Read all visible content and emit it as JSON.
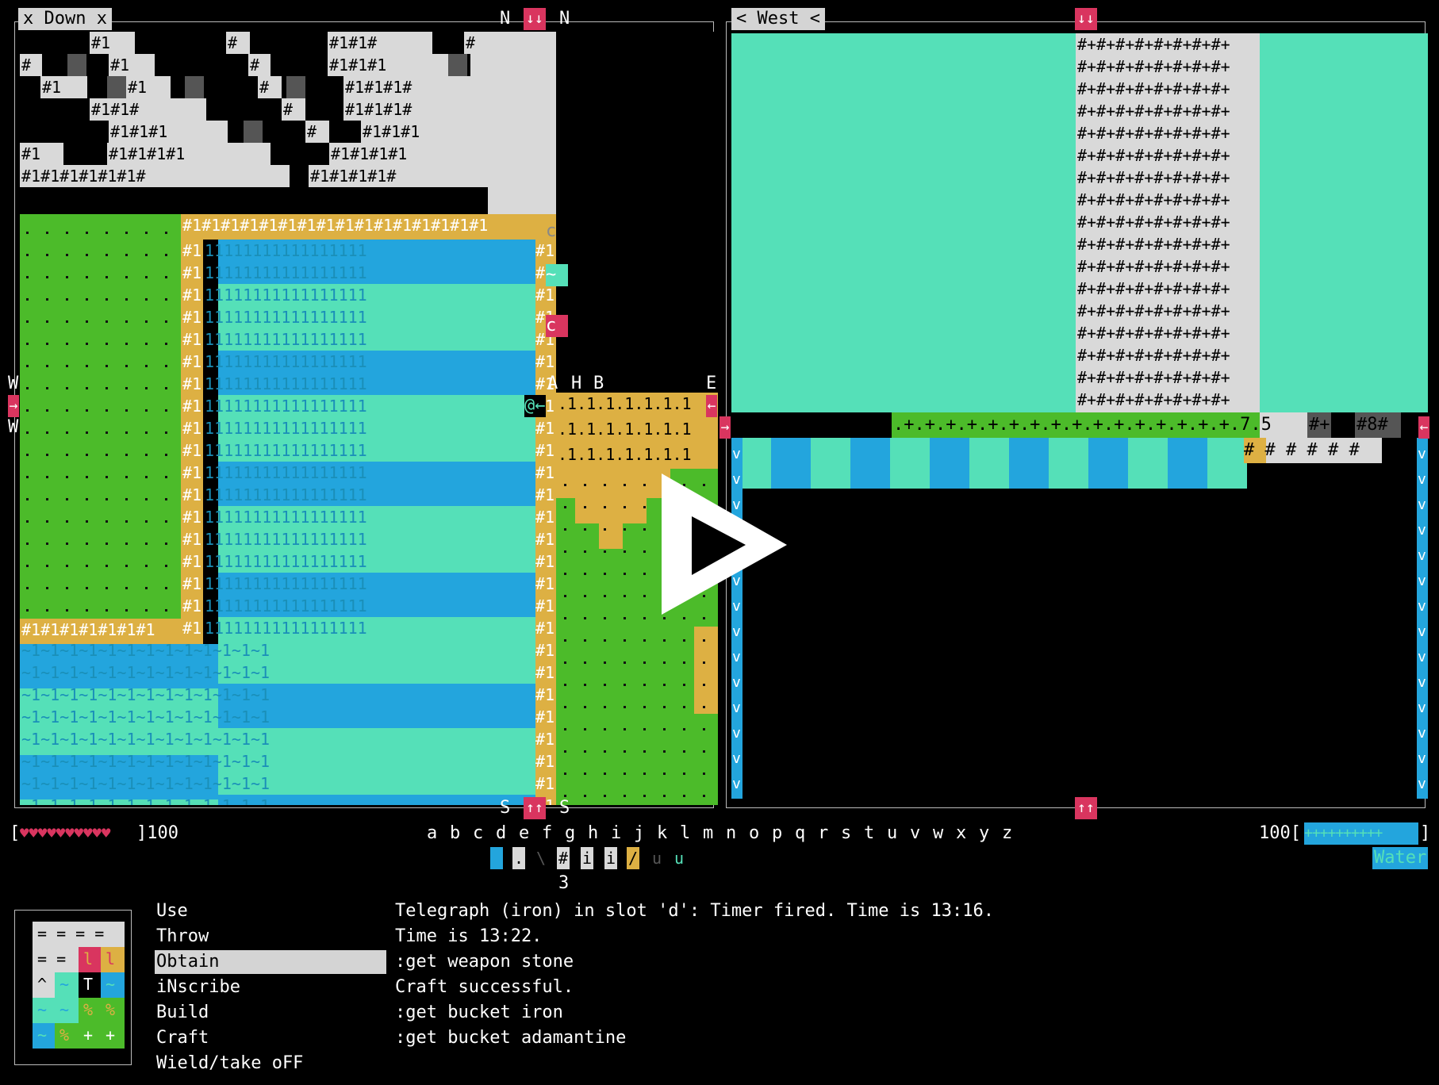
{
  "left_pane": {
    "title": "x Down x",
    "compass": {
      "north": "N",
      "south": "S",
      "west": "W",
      "east": "E"
    },
    "up_arrows": "↑↑",
    "down_arrows": "↓↓",
    "side_letters": [
      "A",
      "H",
      "B"
    ],
    "player_glyph": "@←",
    "side_markers": {
      "c1": "c",
      "tilde": "~",
      "c2": "c"
    }
  },
  "right_pane": {
    "title": "< West <",
    "down_arrows": "↓↓",
    "up_arrows": "↑↑",
    "strip_text": ".+.+.+.+.+.+.+.+.+.+.+.+.+.+.+.+.7.5",
    "strip_tail_1": "#+",
    "strip_tail_2": "#8#",
    "hash_row": "# # # # # #"
  },
  "status": {
    "hearts": "♥♥♥♥♥♥♥♥♥♥",
    "hp_value": "]100",
    "hp_open": "[",
    "mp_value": "100[",
    "mp_bar": "++++++++++",
    "mp_close": "]",
    "mp_label": "Water"
  },
  "hotbar": {
    "letters": [
      "a",
      "b",
      "c",
      "d",
      "e",
      "f",
      "g",
      "h",
      "i",
      "j",
      "k",
      "l",
      "m",
      "n",
      "o",
      "p",
      "q",
      "r",
      "s",
      "t",
      "u",
      "v",
      "w",
      "x",
      "y",
      "z"
    ],
    "slot_count": "3"
  },
  "menu": {
    "items": [
      "Use",
      "Throw",
      "Obtain",
      "iNscribe",
      "Build",
      "Craft",
      "Wield/take oFF"
    ],
    "selected_index": 2
  },
  "messages": [
    "Telegraph (iron) in slot 'd': Timer fired. Time is 13:16.",
    "Time is 13:22.",
    ":get weapon stone",
    "Craft successful.",
    ":get bucket iron",
    ":get bucket adamantine"
  ],
  "colors": {
    "grass": "#4cbb2a",
    "water_light": "#55e0b8",
    "water_dark": "#23a5dd",
    "sand": "#ddb043",
    "stone": "#d9d9d9",
    "accent": "#d9355f",
    "dark_stone": "#555555"
  },
  "icons": {
    "overlay": "play-triangle-icon"
  }
}
